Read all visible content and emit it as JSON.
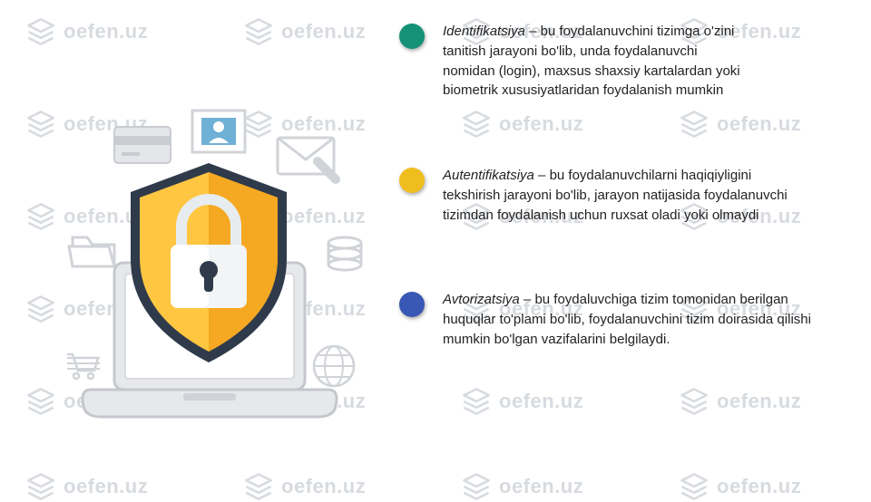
{
  "watermark": {
    "text": "oefen.uz"
  },
  "items": [
    {
      "color": "#159178",
      "term": "Identifikatsiya",
      "body": " – bu foydalanuvchini tizimga o'zini tanitish jarayoni bo'lib, unda foydalanuvchi nomidan (login), maxsus shaxsiy kartalardan yoki biometrik xususiyatlaridan foydalanish mumkin"
    },
    {
      "color": "#f0bd1e",
      "term": "Autentifikatsiya",
      "body": " – bu foydalanuvchilarni haqiqiyligini tekshirish jarayoni bo'lib, jarayon natijasida foydalanuvchi tizimdan foydalanish uchun ruxsat oladi yoki olmaydi"
    },
    {
      "color": "#3957b5",
      "term": "Avtorizatsiya",
      "body": " – bu foydaluvchiga tizim tomonidan berilgan huquqlar to'plami bo'lib, foydalanuvchini tizim doirasida qilishi mumkin bo'lgan vazifalarini belgilaydi."
    }
  ]
}
